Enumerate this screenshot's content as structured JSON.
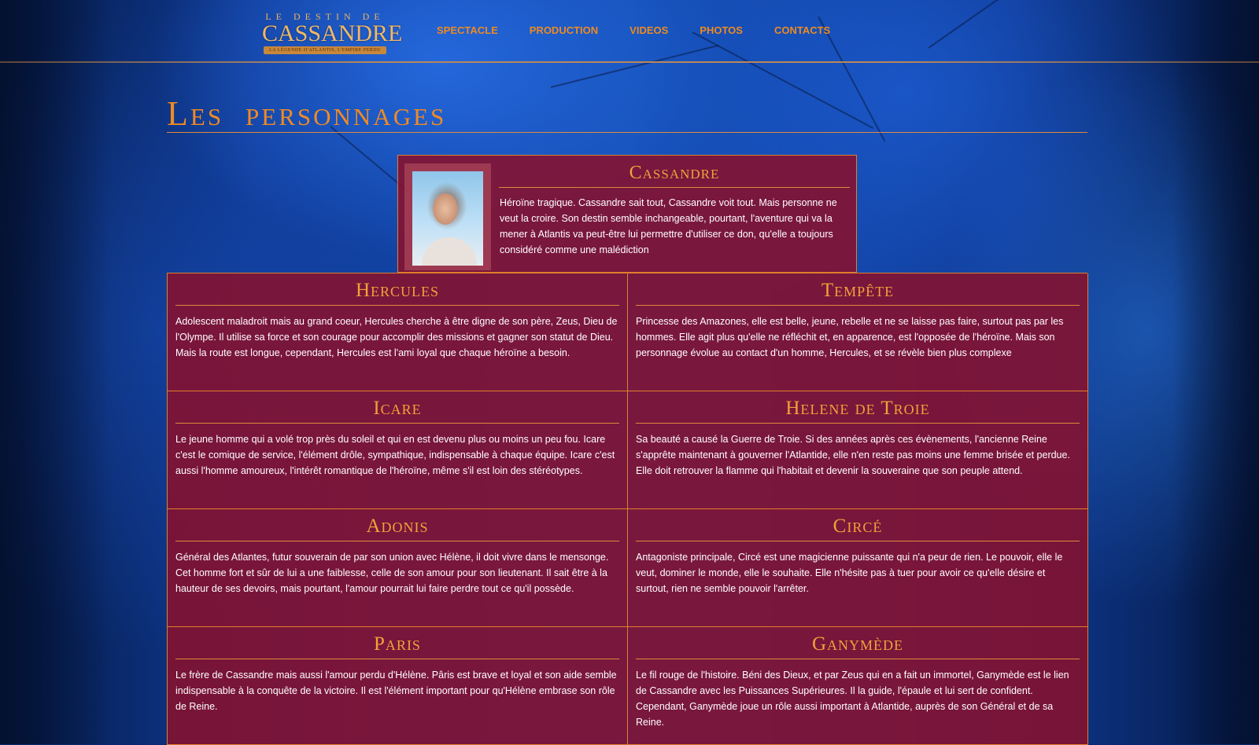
{
  "theme": {
    "accent": "#ee8a1f",
    "card_background": "#87102c",
    "page_background": "#1550b8"
  },
  "header": {
    "logo": {
      "top_text": "LE DESTIN DE",
      "main_text": "CASSANDRE",
      "ribbon_text": "LA LÉGENDE D'ATLANTIS, L'EMPIRE PERDU"
    },
    "nav": [
      "SPECTACLE",
      "PRODUCTION",
      "VIDEOS",
      "PHOTOS",
      "CONTACTS"
    ]
  },
  "page": {
    "title": "Les  personnages"
  },
  "featured": {
    "name": "Cassandre",
    "description": "Héroïne tragique. Cassandre sait tout, Cassandre voit tout. Mais personne ne veut la croire. Son destin semble inchangeable, pourtant, l'aventure qui va la mener à Atlantis va peut-être lui permettre d'utiliser ce don, qu'elle a toujours considéré comme une malédiction"
  },
  "characters": [
    {
      "name": "Hercules",
      "description": "Adolescent maladroit mais au grand coeur, Hercules cherche à être digne de son père, Zeus, Dieu de l'Olympe. Il utilise sa force et son courage pour accomplir des missions et gagner son statut de Dieu. Mais la route est longue, cependant, Hercules est l'ami loyal que chaque héroïne a besoin."
    },
    {
      "name": "Tempête",
      "description": "Princesse des Amazones, elle est belle, jeune, rebelle et ne se laisse pas faire, surtout pas par les hommes. Elle agit plus qu'elle ne réfléchit et, en apparence, est l'opposée de l'héroïne. Mais son personnage évolue au contact d'un homme, Hercules, et se révèle bien plus complexe"
    },
    {
      "name": "Icare",
      "description": "Le jeune homme qui a volé trop près du soleil et qui en est devenu plus ou moins un peu fou. Icare c'est le comique de service, l'élément drôle, sympathique, indispensable à chaque équipe. Icare c'est aussi l'homme amoureux, l'intérêt romantique de l'héroïne, même s'il est loin des stéréotypes."
    },
    {
      "name": "Helene de Troie",
      "description": "Sa beauté a causé la Guerre de Troie. Si des années après ces évènements, l'ancienne Reine s'apprête maintenant à gouverner l'Atlantide, elle n'en reste pas moins une femme brisée et perdue. Elle doit retrouver la flamme qui l'habitait et devenir la souveraine que son peuple attend."
    },
    {
      "name": "Adonis",
      "description": "Général des Atlantes, futur souverain de par son union avec Hélène, il doit vivre dans le mensonge. Cet homme fort et sûr de lui a une faiblesse, celle de son amour pour son lieutenant. Il sait être à la hauteur de ses devoirs, mais pourtant, l'amour pourrait lui faire perdre tout ce qu'il possède."
    },
    {
      "name": "Circé",
      "description": "Antagoniste principale, Circé est une magicienne puissante qui n'a peur de rien. Le pouvoir, elle le veut, dominer le monde, elle le souhaite. Elle n'hésite pas à tuer pour avoir ce qu'elle désire et surtout, rien ne semble pouvoir l'arrêter."
    },
    {
      "name": "Paris",
      "description": "Le frère de Cassandre mais aussi l'amour perdu d'Hélène. Pâris est brave et loyal et son aide semble indispensable à la conquête de la victoire. Il est l'élément important pour qu'Hélène embrase son rôle de Reine."
    },
    {
      "name": "Ganymède",
      "description": "Le fil rouge de l'histoire. Béni des Dieux, et par Zeus qui en a fait un immortel, Ganymède est le lien de Cassandre avec les Puissances Supérieures. Il la guide, l'épaule et lui sert de confident. Cependant, Ganymède joue un rôle aussi important à Atlantide, auprès de son Général et de sa Reine."
    }
  ]
}
